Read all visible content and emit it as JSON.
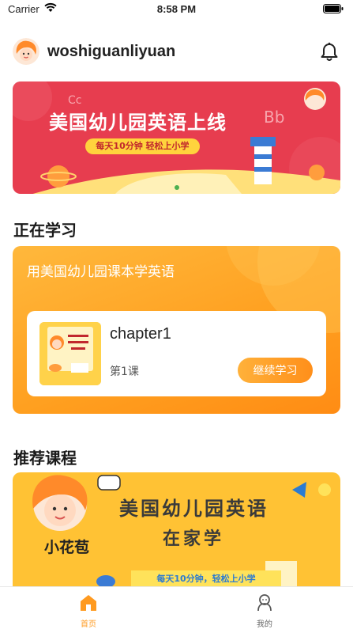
{
  "status_bar": {
    "carrier": "Carrier",
    "time": "8:58 PM"
  },
  "header": {
    "username": "woshiguanliyuan"
  },
  "banner": {
    "title": "美国幼儿园英语上线",
    "subtitle": "每天10分钟  轻松上小学",
    "colors": {
      "background": "#e73d4f",
      "badge": "#ffd33d"
    }
  },
  "studying": {
    "section_title": "正在学习",
    "course_title": "用美国幼儿园课本学英语",
    "chapter": "chapter1",
    "lesson": "第1课",
    "continue_label": "继续学习"
  },
  "recommended": {
    "section_title": "推荐课程",
    "banner_line1": "美国幼儿园英语",
    "banner_line2": "在家学",
    "logo_text": "小花苞",
    "strip_text": "每天10分钟，轻松上小学"
  },
  "tab_bar": {
    "items": [
      {
        "label": "首页",
        "icon": "home-icon",
        "active": true
      },
      {
        "label": "我的",
        "icon": "person-icon",
        "active": false
      }
    ],
    "active_color": "#ff9a1f"
  }
}
